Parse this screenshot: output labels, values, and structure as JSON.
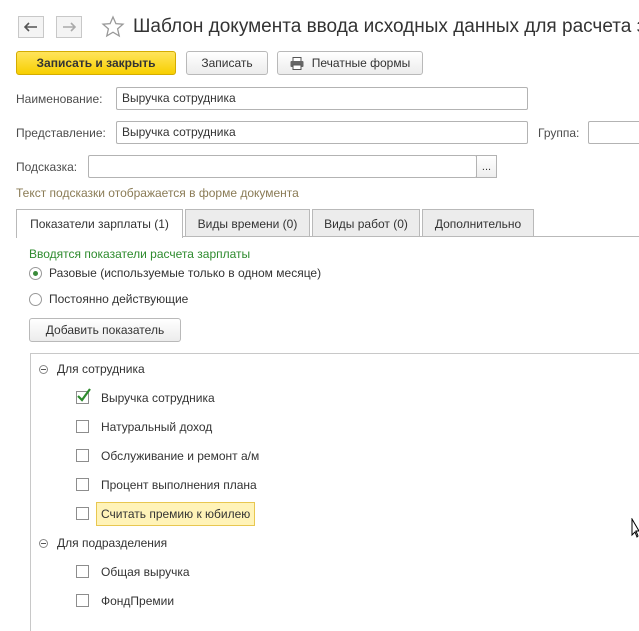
{
  "window": {
    "title": "Шаблон документа ввода исходных данных для расчета за",
    "back_icon": "arrow-left-icon",
    "forward_icon": "arrow-right-icon",
    "favorite_icon": "star-icon"
  },
  "toolbar": {
    "save_close_label": "Записать и закрыть",
    "save_label": "Записать",
    "print_label": "Печатные формы",
    "print_icon": "printer-icon",
    "accent_color": "#f7cf00"
  },
  "form": {
    "name_label": "Наименование:",
    "name_value": "Выручка сотрудника",
    "presentation_label": "Представление:",
    "presentation_value": "Выручка сотрудника",
    "group_label": "Группа:",
    "group_value": "",
    "hint_label": "Подсказка:",
    "hint_value": "",
    "hint_button": "...",
    "hint_note": "Текст подсказки отображается в форме документа"
  },
  "tabs": [
    {
      "label": "Показатели зарплаты (1)",
      "active": true
    },
    {
      "label": "Виды времени (0)",
      "active": false
    },
    {
      "label": "Виды работ (0)",
      "active": false
    },
    {
      "label": "Дополнительно",
      "active": false
    }
  ],
  "indicators": {
    "section_title": "Вводятся показатели расчета зарплаты",
    "radio_options": [
      {
        "label": "Разовые (используемые только в одном месяце)",
        "selected": true
      },
      {
        "label": "Постоянно действующие",
        "selected": false
      }
    ],
    "add_button": "Добавить показатель",
    "groups": [
      {
        "label": "Для сотрудника",
        "items": [
          {
            "label": "Выручка сотрудника",
            "checked": true,
            "selected": false
          },
          {
            "label": "Натуральный доход",
            "checked": false,
            "selected": false
          },
          {
            "label": "Обслуживание и ремонт а/м",
            "checked": false,
            "selected": false
          },
          {
            "label": "Процент выполнения плана",
            "checked": false,
            "selected": false
          },
          {
            "label": "Считать премию к юбилею",
            "checked": false,
            "selected": true
          }
        ]
      },
      {
        "label": "Для подразделения",
        "items": [
          {
            "label": "Общая выручка",
            "checked": false,
            "selected": false
          },
          {
            "label": "ФондПремии",
            "checked": false,
            "selected": false
          }
        ]
      }
    ]
  }
}
